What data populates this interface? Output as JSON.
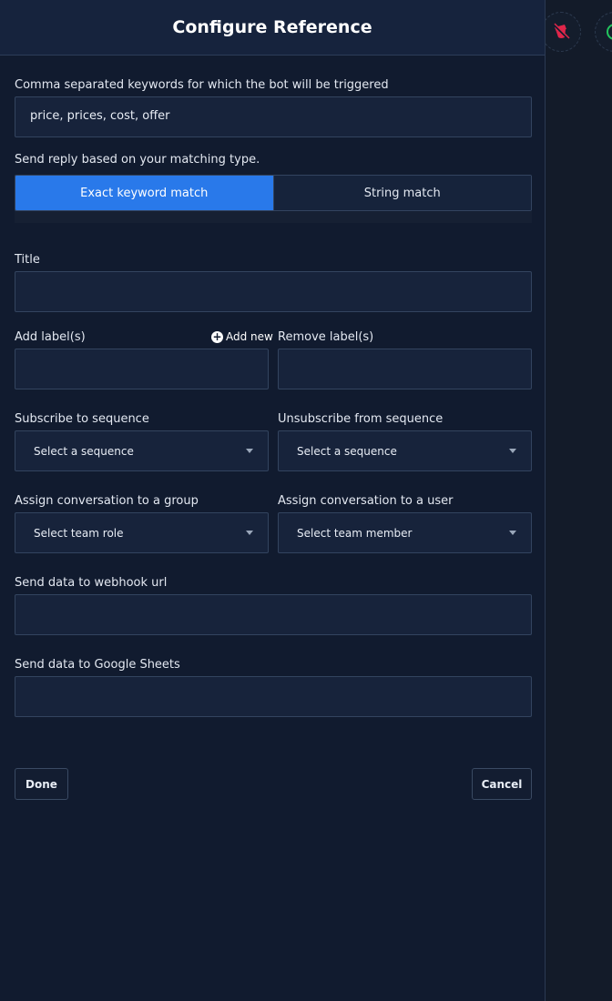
{
  "panel": {
    "title": "Configure Reference"
  },
  "keywords": {
    "label": "Comma separated keywords for which the bot will be triggered",
    "value": "price, prices, cost, offer"
  },
  "matching": {
    "label": "Send reply based on your matching type.",
    "options": [
      {
        "label": "Exact keyword match",
        "active": true
      },
      {
        "label": "String match",
        "active": false
      }
    ]
  },
  "title_field": {
    "label": "Title",
    "value": ""
  },
  "add_labels": {
    "label": "Add label(s)",
    "add_new": "Add new",
    "value": ""
  },
  "remove_labels": {
    "label": "Remove label(s)",
    "value": ""
  },
  "subscribe": {
    "label": "Subscribe to sequence",
    "selected": "Select a sequence"
  },
  "unsubscribe": {
    "label": "Unsubscribe from sequence",
    "selected": "Select a sequence"
  },
  "assign_group": {
    "label": "Assign conversation to a group",
    "selected": "Select team role"
  },
  "assign_user": {
    "label": "Assign conversation to a user",
    "selected": "Select team member"
  },
  "webhook": {
    "label": "Send data to webhook url",
    "value": ""
  },
  "google_sheets": {
    "label": "Send data to Google Sheets",
    "value": ""
  },
  "actions": {
    "done": "Done",
    "cancel": "Cancel"
  },
  "colors": {
    "accent": "#2979ea",
    "panel_bg": "#111b2f",
    "field_bg": "#17233b",
    "delete_icon": "#e0264a",
    "add_icon": "#22c55e"
  },
  "icons": {
    "canvas_delete": "bucket-delete-icon",
    "canvas_add": "add-node-icon",
    "add_new": "plus-circle-icon",
    "select_caret": "caret-down-icon"
  }
}
